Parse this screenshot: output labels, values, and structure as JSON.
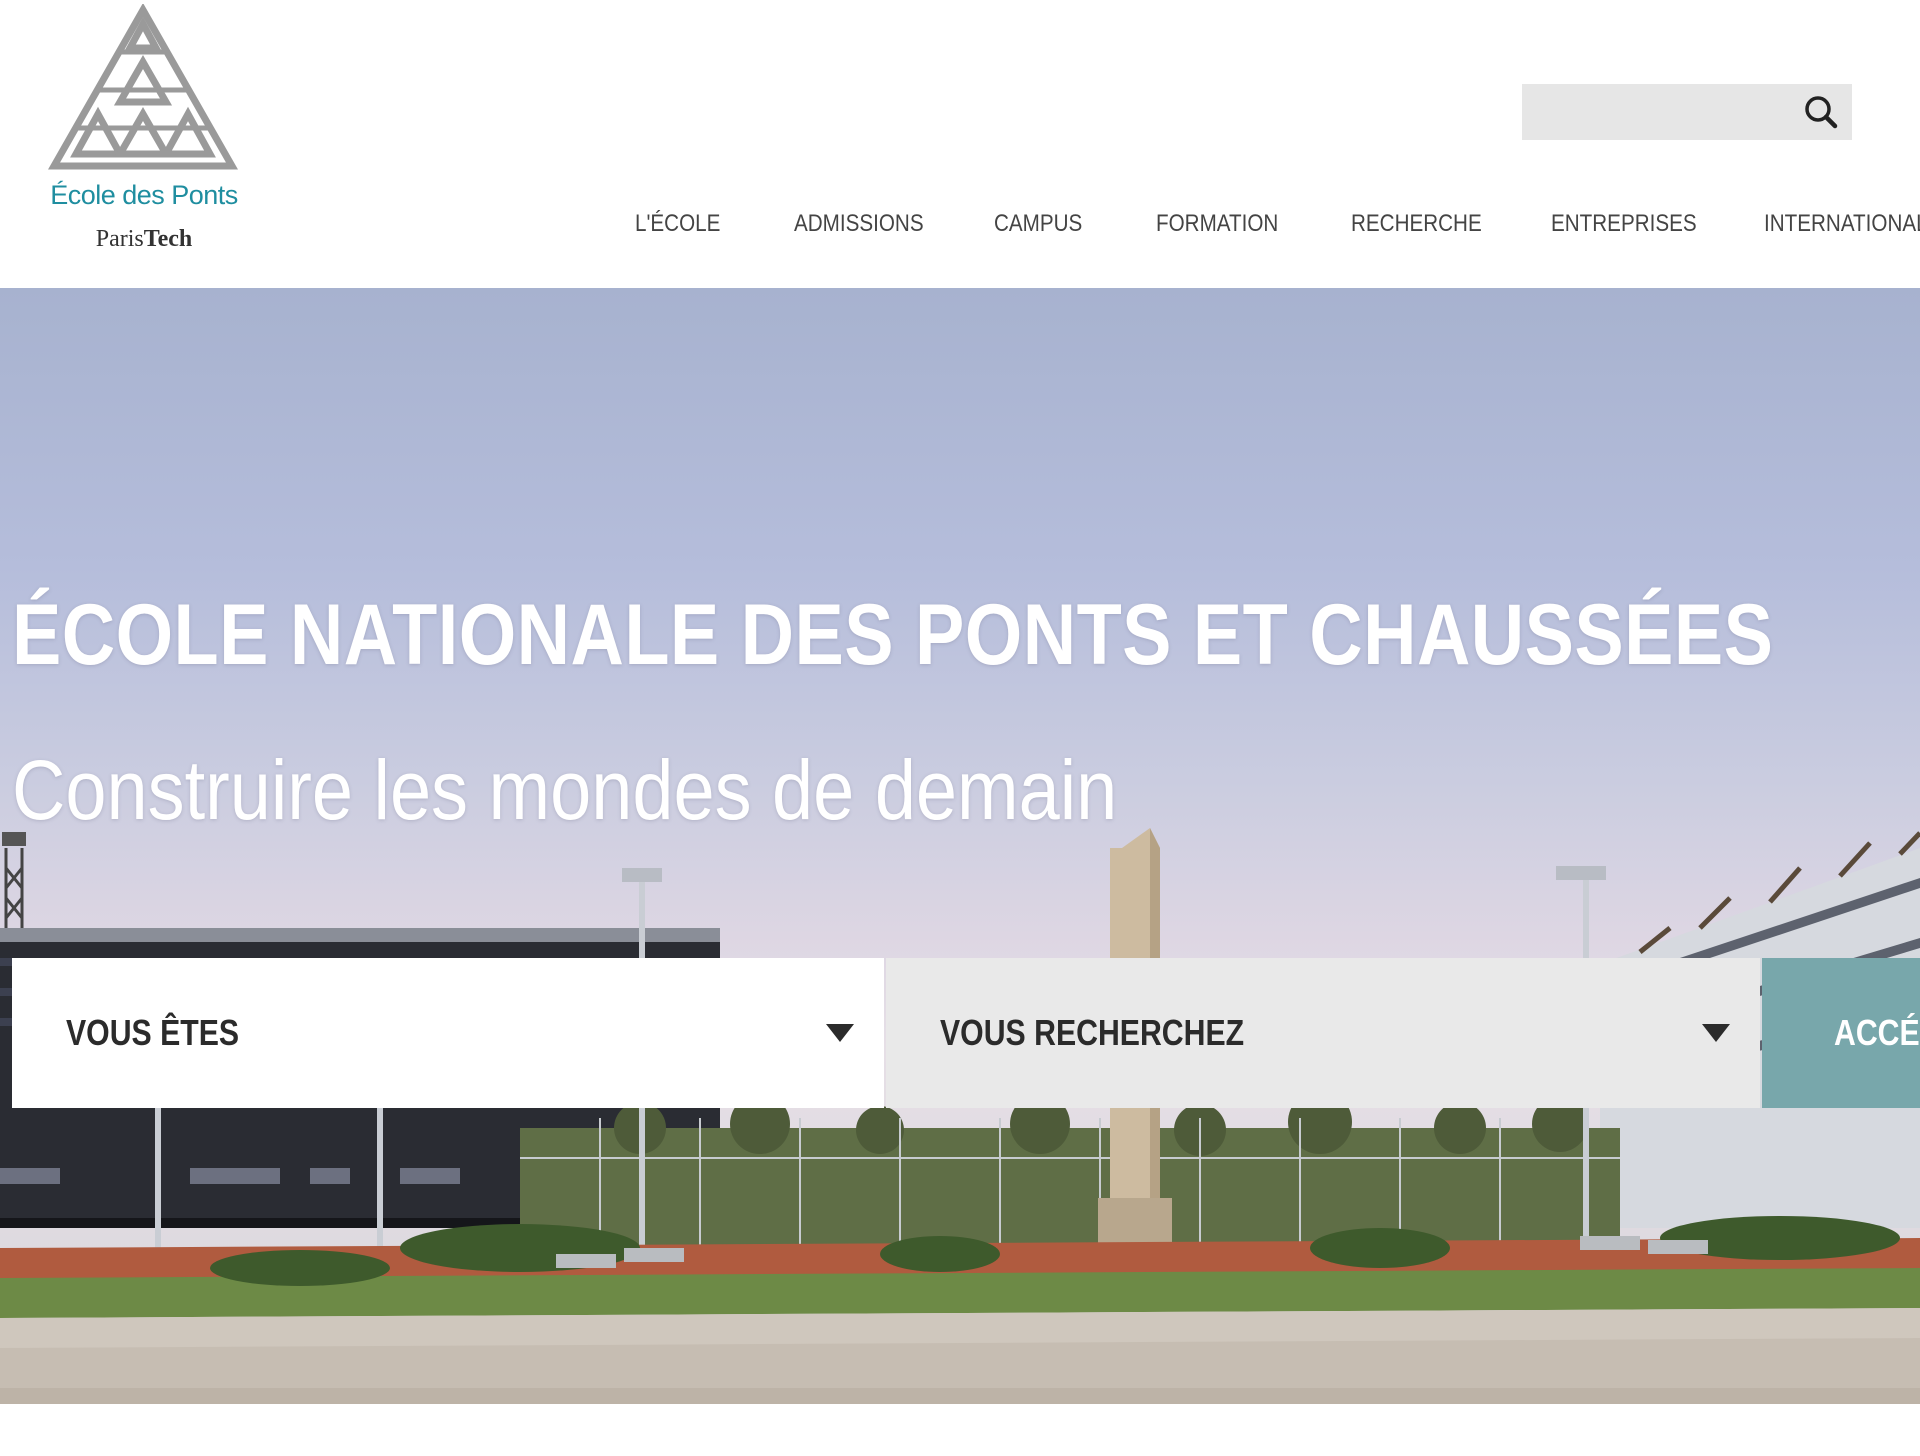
{
  "brand": {
    "logo_line1": "École des Ponts",
    "logo_line2_a": "Paris",
    "logo_line2_b": "Tech",
    "logo_color": "#1f8ea0"
  },
  "search": {
    "value": "",
    "icon": "search-icon"
  },
  "nav": {
    "items": [
      {
        "label": "L'ÉCOLE"
      },
      {
        "label": "ADMISSIONS"
      },
      {
        "label": "CAMPUS"
      },
      {
        "label": "FORMATION"
      },
      {
        "label": "RECHERCHE"
      },
      {
        "label": "ENTREPRISES"
      },
      {
        "label": "INTERNATIONAL"
      }
    ]
  },
  "hero": {
    "title": "ÉCOLE NATIONALE DES PONTS ET CHAUSSÉES",
    "subtitle": "Construire les mondes de demain"
  },
  "filters": {
    "vous_etes": "VOUS ÊTES",
    "vous_recherchez": "VOUS RECHERCHEZ",
    "access_button": "ACCÉDER",
    "access_color": "#78a7ab"
  }
}
